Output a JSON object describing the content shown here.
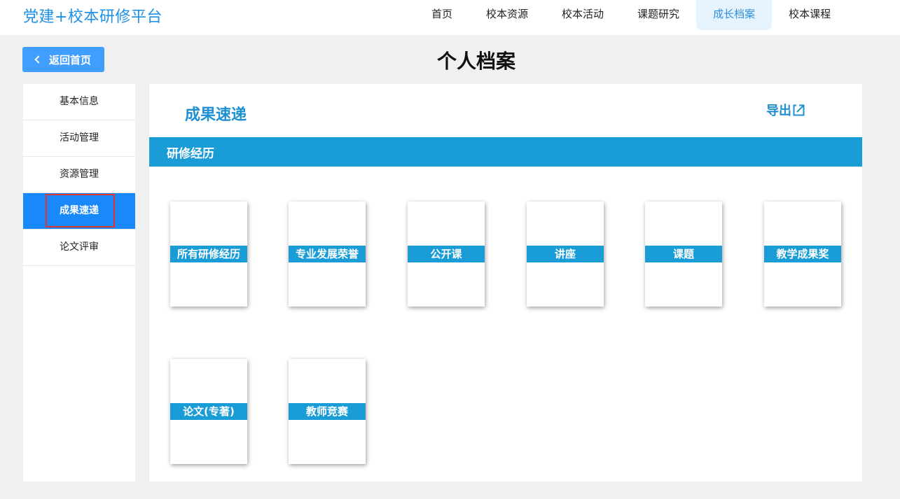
{
  "header": {
    "brand": "党建+校本研修平台",
    "nav": [
      {
        "label": "首页",
        "active": false
      },
      {
        "label": "校本资源",
        "active": false
      },
      {
        "label": "校本活动",
        "active": false
      },
      {
        "label": "课题研究",
        "active": false
      },
      {
        "label": "成长档案",
        "active": true
      },
      {
        "label": "校本课程",
        "active": false
      }
    ]
  },
  "back_button": {
    "label": "返回首页",
    "icon": "chevron-left-icon"
  },
  "page_title": "个人档案",
  "sidebar": {
    "items": [
      {
        "label": "基本信息",
        "active": false
      },
      {
        "label": "活动管理",
        "active": false
      },
      {
        "label": "资源管理",
        "active": false
      },
      {
        "label": "成果速递",
        "active": true
      },
      {
        "label": "论文评审",
        "active": false
      }
    ]
  },
  "main": {
    "section_title": "成果速递",
    "export_label": "导出",
    "export_icon": "external-link-icon",
    "bar_label": "研修经历",
    "cards": [
      {
        "label": "所有研修经历"
      },
      {
        "label": "专业发展荣誉"
      },
      {
        "label": "公开课"
      },
      {
        "label": "讲座"
      },
      {
        "label": "课题"
      },
      {
        "label": "教学成果奖"
      },
      {
        "label": "论文(专著)"
      },
      {
        "label": "教师竞赛"
      }
    ]
  },
  "colors": {
    "accent_blue": "#1a9cd6",
    "brand_blue": "#1e90e6",
    "button_blue": "#409eff",
    "active_sidebar": "#1989fa",
    "highlight_red": "#e0342f"
  }
}
